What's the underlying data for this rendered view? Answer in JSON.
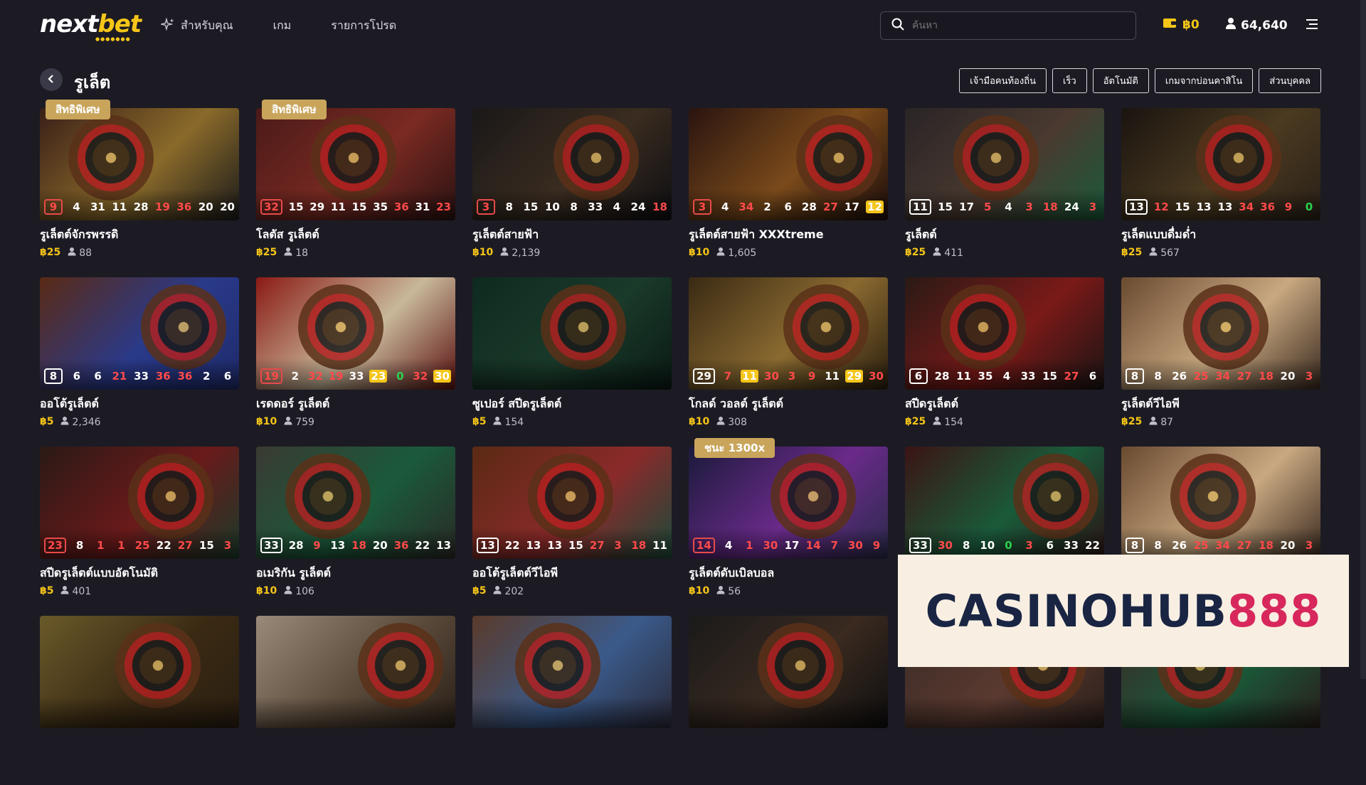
{
  "brand": {
    "next": "next",
    "bet": "bet",
    "dots": "●●●●●●●"
  },
  "nav": [
    {
      "label": "สำหรับคุณ"
    },
    {
      "label": "เกม"
    },
    {
      "label": "รายการโปรด"
    }
  ],
  "search": {
    "placeholder": "ค้นหา"
  },
  "wallet": {
    "balance": "฿0"
  },
  "points": {
    "value": "64,640"
  },
  "page": {
    "title": "รูเล็ต"
  },
  "filters": [
    "เจ้ามือคนท้องถิ่น",
    "เร็ว",
    "อัตโนมัติ",
    "เกมจากบ่อนคาสิโน",
    "ส่วนบุคคล"
  ],
  "games": [
    {
      "badge": "สิทธิพิเศษ",
      "name": "รูเล็ตต์จักรพรรดิ",
      "bet": "฿25",
      "players": "88",
      "nums": [
        [
          "9",
          "r"
        ],
        [
          "4",
          "w"
        ],
        [
          "31",
          "w"
        ],
        [
          "11",
          "w"
        ],
        [
          "28",
          "w"
        ],
        [
          "19",
          "r"
        ],
        [
          "36",
          "r"
        ],
        [
          "20",
          "w"
        ],
        [
          "20",
          "w"
        ]
      ],
      "bg": [
        "#3a1f18",
        "#8a6a2a",
        "#1a1a1a"
      ]
    },
    {
      "badge": "สิทธิพิเศษ",
      "name": "โลตัส รูเล็ตต์",
      "bet": "฿25",
      "players": "18",
      "nums": [
        [
          "32",
          "r"
        ],
        [
          "15",
          "w"
        ],
        [
          "29",
          "w"
        ],
        [
          "11",
          "w"
        ],
        [
          "15",
          "w"
        ],
        [
          "35",
          "w"
        ],
        [
          "36",
          "r"
        ],
        [
          "31",
          "w"
        ],
        [
          "23",
          "r"
        ]
      ],
      "bg": [
        "#4a1a18",
        "#7a2a22",
        "#2a1212"
      ]
    },
    {
      "badge": "",
      "name": "รูเล็ตต์สายฟ้า",
      "bet": "฿10",
      "players": "2,139",
      "nums": [
        [
          "3",
          "r"
        ],
        [
          "8",
          "w"
        ],
        [
          "15",
          "w"
        ],
        [
          "10",
          "w"
        ],
        [
          "8",
          "w"
        ],
        [
          "33",
          "w"
        ],
        [
          "4",
          "w"
        ],
        [
          "24",
          "w"
        ],
        [
          "18",
          "r"
        ]
      ],
      "bg": [
        "#1a1818",
        "#3a2c20",
        "#0e0e12"
      ]
    },
    {
      "badge": "",
      "name": "รูเล็ตต์สายฟ้า XXXtreme",
      "bet": "฿10",
      "players": "1,605",
      "nums": [
        [
          "3",
          "r"
        ],
        [
          "4",
          "w"
        ],
        [
          "34",
          "r"
        ],
        [
          "2",
          "w"
        ],
        [
          "6",
          "w"
        ],
        [
          "28",
          "w"
        ],
        [
          "27",
          "r"
        ],
        [
          "17",
          "w"
        ],
        [
          "12",
          "hi"
        ]
      ],
      "bg": [
        "#2a1410",
        "#7a4a1a",
        "#1a0c0a"
      ]
    },
    {
      "badge": "",
      "name": "รูเล็ตต์",
      "bet": "฿25",
      "players": "411",
      "nums": [
        [
          "11",
          "w"
        ],
        [
          "15",
          "w"
        ],
        [
          "17",
          "w"
        ],
        [
          "5",
          "r"
        ],
        [
          "4",
          "w"
        ],
        [
          "3",
          "r"
        ],
        [
          "18",
          "r"
        ],
        [
          "24",
          "w"
        ],
        [
          "3",
          "r"
        ]
      ],
      "bg": [
        "#2a2426",
        "#4a3a30",
        "#1a5a3a"
      ]
    },
    {
      "badge": "",
      "name": "รูเล็ตแบบดื่มด่ำ",
      "bet": "฿25",
      "players": "567",
      "nums": [
        [
          "13",
          "w"
        ],
        [
          "12",
          "r"
        ],
        [
          "15",
          "w"
        ],
        [
          "13",
          "w"
        ],
        [
          "13",
          "w"
        ],
        [
          "34",
          "r"
        ],
        [
          "36",
          "r"
        ],
        [
          "9",
          "r"
        ],
        [
          "0",
          "g"
        ]
      ],
      "bg": [
        "#1a1410",
        "#4a3a20",
        "#2a2018"
      ]
    },
    {
      "badge": "",
      "name": "ออโต้รูเล็ตต์",
      "bet": "฿5",
      "players": "2,346",
      "nums": [
        [
          "8",
          "w"
        ],
        [
          "6",
          "w"
        ],
        [
          "6",
          "w"
        ],
        [
          "21",
          "r"
        ],
        [
          "33",
          "w"
        ],
        [
          "36",
          "r"
        ],
        [
          "36",
          "r"
        ],
        [
          "2",
          "w"
        ],
        [
          "6",
          "w"
        ]
      ],
      "bg": [
        "#5a2a14",
        "#2a3a8a",
        "#1e2a6a"
      ]
    },
    {
      "badge": "",
      "name": "เรดดอร์ รูเล็ตต์",
      "bet": "฿10",
      "players": "759",
      "nums": [
        [
          "19",
          "r"
        ],
        [
          "2",
          "w"
        ],
        [
          "32",
          "r"
        ],
        [
          "19",
          "r"
        ],
        [
          "33",
          "w"
        ],
        [
          "23",
          "hi"
        ],
        [
          "0",
          "g"
        ],
        [
          "32",
          "r"
        ],
        [
          "30",
          "hi"
        ]
      ],
      "bg": [
        "#8a1a14",
        "#c8b89a",
        "#5a1010"
      ]
    },
    {
      "badge": "",
      "name": "ซูเปอร์ สปีดรูเล็ตต์",
      "bet": "฿5",
      "players": "154",
      "nums": [],
      "bg": [
        "#0e2a20",
        "#1a3a2a",
        "#0a1a14"
      ]
    },
    {
      "badge": "",
      "name": "โกลด์ วอลต์ รูเล็ตต์",
      "bet": "฿10",
      "players": "308",
      "nums": [
        [
          "29",
          "w"
        ],
        [
          "7",
          "r"
        ],
        [
          "11",
          "hi"
        ],
        [
          "30",
          "r"
        ],
        [
          "3",
          "r"
        ],
        [
          "9",
          "r"
        ],
        [
          "11",
          "w"
        ],
        [
          "29",
          "hi"
        ],
        [
          "30",
          "r"
        ]
      ],
      "bg": [
        "#3a2a14",
        "#8a6a30",
        "#2a1e0e"
      ]
    },
    {
      "badge": "",
      "name": "สปีดรูเล็ตต์",
      "bet": "฿25",
      "players": "154",
      "nums": [
        [
          "6",
          "w"
        ],
        [
          "28",
          "w"
        ],
        [
          "11",
          "w"
        ],
        [
          "35",
          "w"
        ],
        [
          "4",
          "w"
        ],
        [
          "33",
          "w"
        ],
        [
          "15",
          "w"
        ],
        [
          "27",
          "r"
        ],
        [
          "6",
          "w"
        ]
      ],
      "bg": [
        "#2a1a16",
        "#7a1a18",
        "#1a1414"
      ]
    },
    {
      "badge": "",
      "name": "รูเล็ตต์วีไอพี",
      "bet": "฿25",
      "players": "87",
      "nums": [
        [
          "8",
          "w"
        ],
        [
          "8",
          "w"
        ],
        [
          "26",
          "w"
        ],
        [
          "25",
          "r"
        ],
        [
          "34",
          "r"
        ],
        [
          "27",
          "r"
        ],
        [
          "18",
          "r"
        ],
        [
          "20",
          "w"
        ],
        [
          "3",
          "r"
        ]
      ],
      "bg": [
        "#6a4a30",
        "#c8a880",
        "#3a2a20"
      ]
    },
    {
      "badge": "",
      "name": "สปีดรูเล็ตต์แบบอัตโนมัติ",
      "bet": "฿5",
      "players": "401",
      "nums": [
        [
          "23",
          "r"
        ],
        [
          "8",
          "w"
        ],
        [
          "1",
          "r"
        ],
        [
          "1",
          "r"
        ],
        [
          "25",
          "r"
        ],
        [
          "22",
          "w"
        ],
        [
          "27",
          "r"
        ],
        [
          "15",
          "w"
        ],
        [
          "3",
          "r"
        ]
      ],
      "bg": [
        "#2a1a16",
        "#6a1a1a",
        "#1a3a2a"
      ]
    },
    {
      "badge": "",
      "name": "อเมริกัน รูเล็ตต์",
      "bet": "฿10",
      "players": "106",
      "nums": [
        [
          "33",
          "w"
        ],
        [
          "28",
          "w"
        ],
        [
          "9",
          "r"
        ],
        [
          "13",
          "w"
        ],
        [
          "18",
          "r"
        ],
        [
          "20",
          "w"
        ],
        [
          "36",
          "r"
        ],
        [
          "22",
          "w"
        ],
        [
          "13",
          "w"
        ]
      ],
      "bg": [
        "#3a3a32",
        "#1a5a3a",
        "#2a2a26"
      ]
    },
    {
      "badge": "",
      "name": "ออโต้รูเล็ตต์วีไอพี",
      "bet": "฿5",
      "players": "202",
      "nums": [
        [
          "13",
          "w"
        ],
        [
          "22",
          "w"
        ],
        [
          "13",
          "w"
        ],
        [
          "13",
          "w"
        ],
        [
          "15",
          "w"
        ],
        [
          "27",
          "r"
        ],
        [
          "3",
          "r"
        ],
        [
          "18",
          "r"
        ],
        [
          "11",
          "w"
        ]
      ],
      "bg": [
        "#5a2a14",
        "#8a2a2a",
        "#1a4a3a"
      ]
    },
    {
      "badge": "ชนะ 1300x",
      "name": "รูเล็ตต์ดับเบิลบอล",
      "bet": "฿10",
      "players": "56",
      "nums": [
        [
          "14",
          "r"
        ],
        [
          "4",
          "w"
        ],
        [
          "1",
          "r"
        ],
        [
          "30",
          "r"
        ],
        [
          "17",
          "w"
        ],
        [
          "14",
          "r"
        ],
        [
          "7",
          "r"
        ],
        [
          "30",
          "r"
        ],
        [
          "9",
          "r"
        ]
      ],
      "bg": [
        "#1a1a3a",
        "#6a2a8a",
        "#2a2a4a"
      ]
    },
    {
      "badge": "",
      "name": "",
      "bet": "",
      "players": "",
      "nums": [
        [
          "33",
          "w"
        ],
        [
          "30",
          "r"
        ],
        [
          "8",
          "w"
        ],
        [
          "10",
          "w"
        ],
        [
          "0",
          "g"
        ],
        [
          "3",
          "r"
        ],
        [
          "6",
          "w"
        ],
        [
          "33",
          "w"
        ],
        [
          "22",
          "w"
        ]
      ],
      "bg": [
        "#3a1414",
        "#1a5a3a",
        "#2a1414"
      ]
    },
    {
      "badge": "",
      "name": "",
      "bet": "",
      "players": "",
      "nums": [
        [
          "8",
          "w"
        ],
        [
          "8",
          "w"
        ],
        [
          "26",
          "w"
        ],
        [
          "25",
          "r"
        ],
        [
          "34",
          "r"
        ],
        [
          "27",
          "r"
        ],
        [
          "18",
          "r"
        ],
        [
          "20",
          "w"
        ],
        [
          "3",
          "r"
        ]
      ],
      "bg": [
        "#6a4a30",
        "#c8a880",
        "#3a2a20"
      ]
    },
    {
      "badge": "",
      "name": "",
      "bet": "",
      "players": "",
      "nums": [],
      "bg": [
        "#6a5a2a",
        "#3a2a14",
        "#2a1e10"
      ]
    },
    {
      "badge": "",
      "name": "",
      "bet": "",
      "players": "",
      "nums": [],
      "bg": [
        "#9a8a7a",
        "#5a4a3a",
        "#2a2018"
      ]
    },
    {
      "badge": "",
      "name": "",
      "bet": "",
      "players": "",
      "nums": [],
      "bg": [
        "#5a3a2a",
        "#3a5a8a",
        "#2a2a3a"
      ]
    },
    {
      "badge": "",
      "name": "",
      "bet": "",
      "players": "",
      "nums": [],
      "bg": [
        "#1a1a1a",
        "#3a2a20",
        "#0e0e0e"
      ]
    },
    {
      "badge": "",
      "name": "",
      "bet": "",
      "players": "",
      "nums": [],
      "bg": [
        "#3a2a26",
        "#5a3a30",
        "#2a1e1a"
      ]
    },
    {
      "badge": "",
      "name": "",
      "bet": "",
      "players": "",
      "nums": [],
      "bg": [
        "#3a2a26",
        "#1a5a3a",
        "#2a1e1a"
      ]
    }
  ],
  "promo": {
    "part1": "CASINOHUB",
    "part2": "888"
  }
}
